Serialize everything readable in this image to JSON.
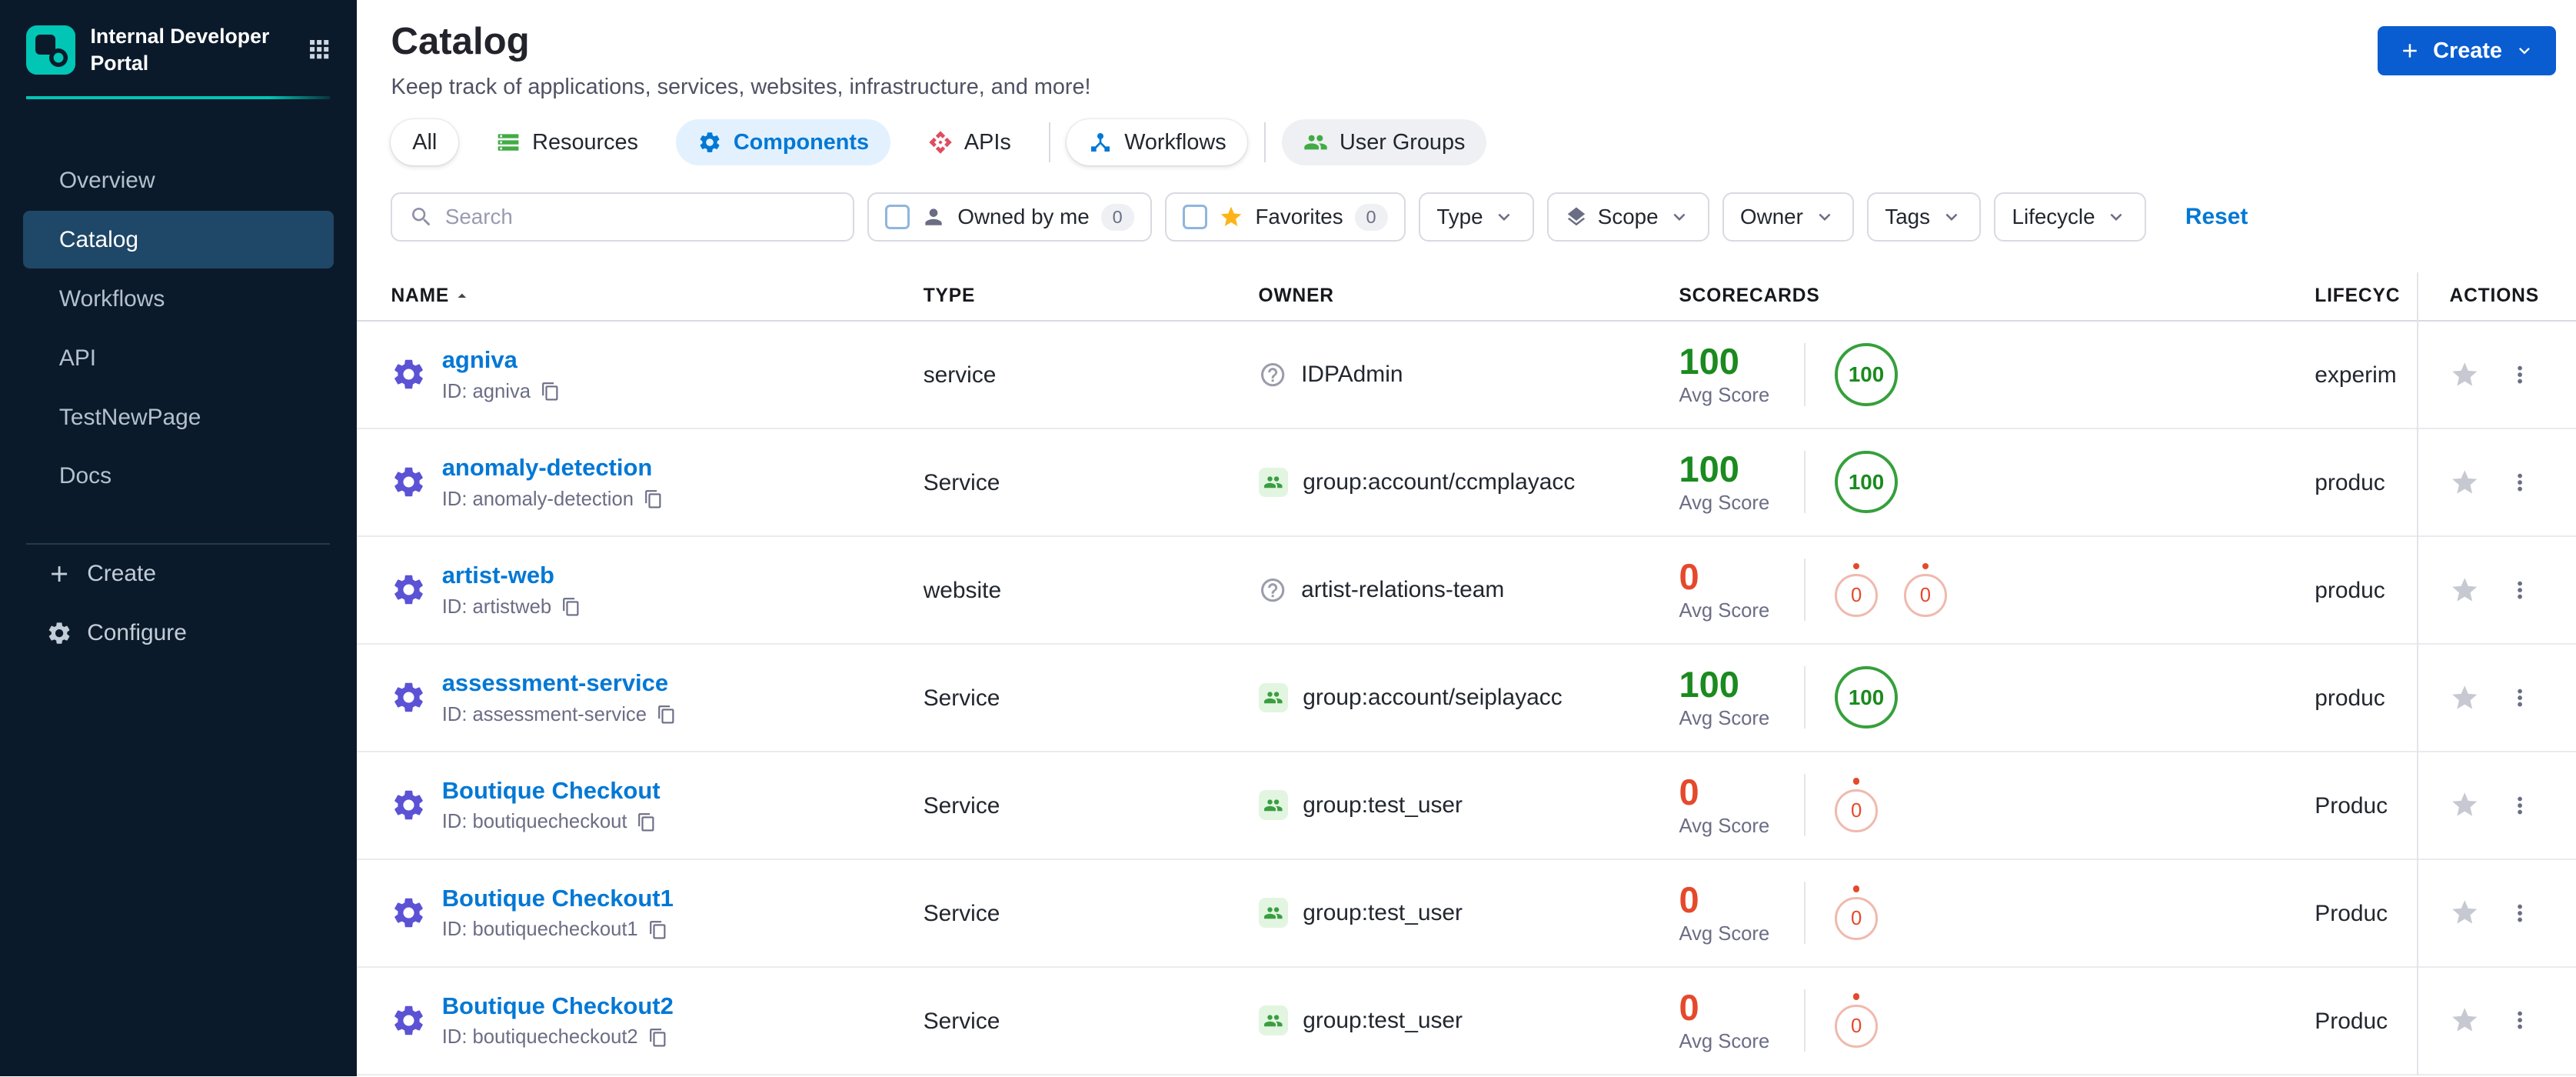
{
  "colors": {
    "accent": "#0278d5",
    "button-blue": "#0a5dd0",
    "teal": "#01c5b5",
    "green": "#1b8a1f",
    "green-ring": "#35a03b",
    "red": "#e5492c",
    "red-ring": "#f0b9ae",
    "indigo": "#5b52d5",
    "sidebar-bg": "#0b1a2a",
    "sidebar-selected": "#1f4767",
    "star-yellow": "#fcb519"
  },
  "sidebar": {
    "logo_title": "Internal Developer Portal",
    "items": [
      {
        "label": "Overview"
      },
      {
        "label": "Catalog"
      },
      {
        "label": "Workflows"
      },
      {
        "label": "API"
      },
      {
        "label": "TestNewPage"
      },
      {
        "label": "Docs"
      }
    ],
    "create_label": "Create",
    "configure_label": "Configure"
  },
  "header": {
    "title": "Catalog",
    "subtitle": "Keep track of applications, services, websites, infrastructure, and more!",
    "create_button": "Create"
  },
  "tabs": {
    "all": "All",
    "resources": "Resources",
    "components": "Components",
    "apis": "APIs",
    "workflows": "Workflows",
    "user_groups": "User Groups"
  },
  "filters": {
    "search_placeholder": "Search",
    "owned_by_me": {
      "label": "Owned by me",
      "count": "0"
    },
    "favorites": {
      "label": "Favorites",
      "count": "0"
    },
    "type": "Type",
    "scope": "Scope",
    "owner": "Owner",
    "tags": "Tags",
    "lifecycle": "Lifecycle",
    "reset": "Reset"
  },
  "table": {
    "headers": {
      "name": "NAME",
      "type": "TYPE",
      "owner": "OWNER",
      "scorecards": "SCORECARDS",
      "lifecycle": "LIFECYC",
      "actions": "ACTIONS"
    },
    "avg_score_label": "Avg Score",
    "rows": [
      {
        "name": "agniva",
        "id": "ID: agniva",
        "type": "service",
        "owner": "IDPAdmin",
        "avg_score": "100",
        "badge1": "100",
        "lifecycle": "experim"
      },
      {
        "name": "anomaly-detection",
        "id": "ID: anomaly-detection",
        "type": "Service",
        "owner": "group:account/ccmplayacc",
        "avg_score": "100",
        "badge1": "100",
        "lifecycle": "produc"
      },
      {
        "name": "artist-web",
        "id": "ID: artistweb",
        "type": "website",
        "owner": "artist-relations-team",
        "avg_score": "0",
        "badge1": "0",
        "badge2": "0",
        "lifecycle": "produc"
      },
      {
        "name": "assessment-service",
        "id": "ID: assessment-service",
        "type": "Service",
        "owner": "group:account/seiplayacc",
        "avg_score": "100",
        "badge1": "100",
        "lifecycle": "produc"
      },
      {
        "name": "Boutique Checkout",
        "id": "ID: boutiquecheckout",
        "type": "Service",
        "owner": "group:test_user",
        "avg_score": "0",
        "badge1": "0",
        "lifecycle": "Produc"
      },
      {
        "name": "Boutique Checkout1",
        "id": "ID: boutiquecheckout1",
        "type": "Service",
        "owner": "group:test_user",
        "avg_score": "0",
        "badge1": "0",
        "lifecycle": "Produc"
      },
      {
        "name": "Boutique Checkout2",
        "id": "ID: boutiquecheckout2",
        "type": "Service",
        "owner": "group:test_user",
        "avg_score": "0",
        "badge1": "0",
        "lifecycle": "Produc"
      }
    ]
  }
}
